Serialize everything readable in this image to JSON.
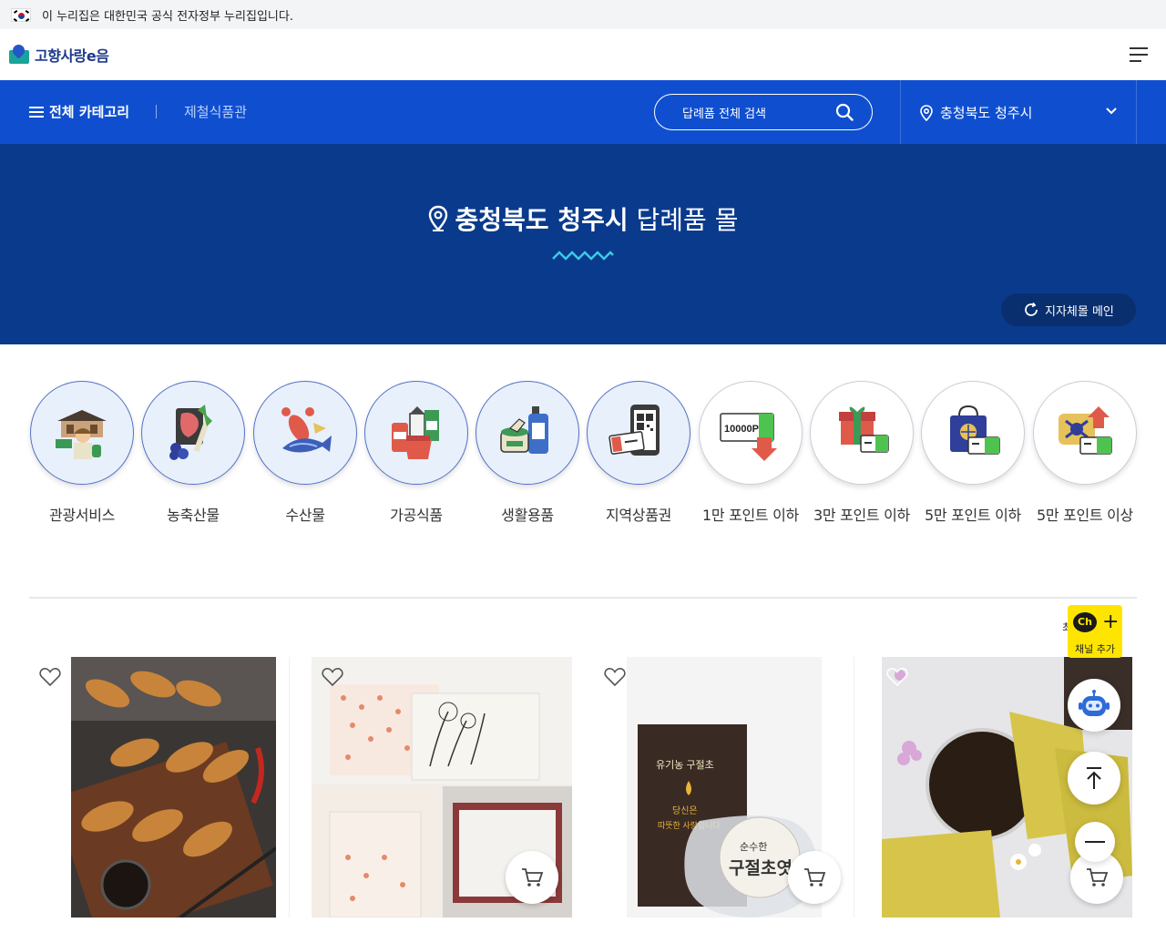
{
  "gov_banner": {
    "text": "이 누리집은 대한민국 공식 전자정부 누리집입니다."
  },
  "header": {
    "logo_text": "고향사랑e음"
  },
  "nav": {
    "category_label": "전체 카테고리",
    "link_label": "제철식품관",
    "search_placeholder": "답례품 전체 검색",
    "region_label": "충청북도 청주시"
  },
  "hero": {
    "region": "충청북도 청주시",
    "suffix": "답례품 몰",
    "main_button": "지자체몰 메인"
  },
  "categories": [
    {
      "label": "관광서비스",
      "icon": "tour-service-icon"
    },
    {
      "label": "농축산물",
      "icon": "agri-livestock-icon"
    },
    {
      "label": "수산물",
      "icon": "seafood-icon"
    },
    {
      "label": "가공식품",
      "icon": "processed-food-icon"
    },
    {
      "label": "생활용품",
      "icon": "household-goods-icon"
    },
    {
      "label": "지역상품권",
      "icon": "local-voucher-icon"
    },
    {
      "label": "1만 포인트 이하",
      "icon": "point-10000-icon",
      "badge": "10000P"
    },
    {
      "label": "3만 포인트 이하",
      "icon": "point-30000-icon"
    },
    {
      "label": "5만 포인트 이하",
      "icon": "point-50000-icon"
    },
    {
      "label": "5만 포인트 이상",
      "icon": "point-over-50000-icon"
    }
  ],
  "sort_fragment": "최",
  "floating": {
    "kakao_bubble": "Ch",
    "kakao_plus": "+",
    "kakao_label": "채널 추가"
  },
  "products": [
    {
      "image": "fried-dumplings",
      "image_texts": []
    },
    {
      "image": "flower-print-paper-set",
      "image_texts": []
    },
    {
      "image": "organic-syrup-package",
      "image_texts": [
        "유기농 구절초",
        "당신은",
        "따뜻한 사랑입니다",
        "순수한",
        "구절초엿"
      ]
    },
    {
      "image": "herbal-tea-pouches",
      "image_texts": []
    }
  ],
  "colors": {
    "nav_blue": "#0f4fcf",
    "hero_navy": "#0a3a8c",
    "kakao_yellow": "#fee500"
  }
}
